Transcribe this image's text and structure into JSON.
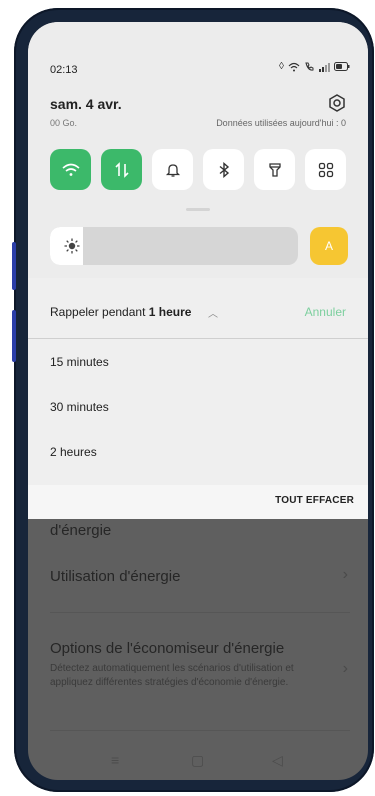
{
  "status_bar": {
    "time": "02:13"
  },
  "header": {
    "date": "sam. 4 avr.",
    "data_left": "00 Go.",
    "data_right": "Données utilisées aujourd'hui : 0"
  },
  "quick_tiles": [
    {
      "icon": "wifi-icon",
      "active": true
    },
    {
      "icon": "mobile-data-icon",
      "active": true
    },
    {
      "icon": "bell-icon",
      "active": false
    },
    {
      "icon": "bluetooth-icon",
      "active": false
    },
    {
      "icon": "flashlight-icon",
      "active": false
    },
    {
      "icon": "grid-icon",
      "active": false
    }
  ],
  "brightness": {
    "level": 0.1,
    "auto_label": "A",
    "accent": "#f6c632"
  },
  "snooze": {
    "prefix": "Rappeler pendant",
    "duration": "1 heure",
    "cancel": "Annuler",
    "options": [
      "15 minutes",
      "30 minutes",
      "2 heures"
    ],
    "clear_all": "TOUT EFFACER"
  },
  "background_page": {
    "partial_title": "d'énergie",
    "item_usage": "Utilisation d'énergie",
    "item_options_title": "Options de l'économiseur d'énergie",
    "item_options_desc": "Détectez automatiquement les scénarios d'utilisation et appliquez différentes stratégies d'économie d'énergie."
  },
  "colors": {
    "tile_active": "#3cb96a",
    "cancel_text": "#7ccf9e"
  }
}
